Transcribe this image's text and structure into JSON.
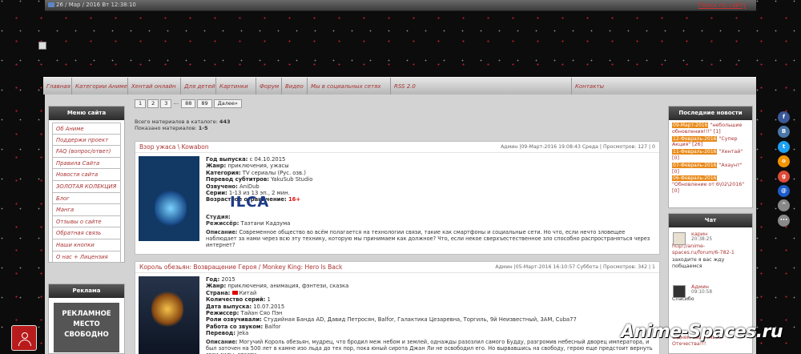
{
  "topbar": {
    "date": "26 / Мар / 2016 Вт 12:38:10",
    "search": "Поиск по сайту"
  },
  "nav": [
    {
      "label": "Главная"
    },
    {
      "label": "Категории Аниме"
    },
    {
      "label": "Хентай онлайн"
    },
    {
      "label": "Для детей"
    },
    {
      "label": "Картинки"
    },
    {
      "label": "Форум"
    },
    {
      "label": "Видео"
    },
    {
      "label": "Мы в социальных сетях"
    },
    {
      "label": "RSS 2.0"
    },
    {
      "label": "Контакты"
    }
  ],
  "menu": {
    "title": "Меню сайта",
    "items": [
      "Об Аниме",
      "Поддержи проект",
      "FAQ (вопрос/ответ)",
      "Правила Сайта",
      "Новости сайта",
      "ЗОЛОТАЯ КОЛЕКЦИЯ",
      "Блог",
      "Манга",
      "Отзывы о сайте",
      "Обратная связь",
      "Наши кнопки",
      "О нас + Лицензия"
    ]
  },
  "ad": {
    "title": "Реклама",
    "line1": "РЕКЛАМНОЕ",
    "line2": "МЕСТО",
    "line3": "СВОБОДНО"
  },
  "pager": {
    "pages": [
      "1",
      "2",
      "3"
    ],
    "ellipsis": "...",
    "pages2": [
      "88",
      "89"
    ],
    "next": "Далее»"
  },
  "stats": {
    "total_label": "Всего материалов в каталоге:",
    "total": "443",
    "shown_label": "Показано материалов:",
    "shown": "1-5"
  },
  "entries": [
    {
      "title": "Взор ужаса \\ Kowabon",
      "meta": "Админ |09-Март-2016 19:08:43 Среда | Просмотров: 127 | 0",
      "fields": [
        {
          "k": "Год выпуска:",
          "v": "с 04.10.2015"
        },
        {
          "k": "Жанр:",
          "v": "приключения, ужасы"
        },
        {
          "k": "Категория:",
          "v": "TV сериалы (Рус. озв.)"
        },
        {
          "k": "Перевод субтитров:",
          "v": "YakuSub Studio"
        },
        {
          "k": "Озвучено:",
          "v": "AniDub"
        },
        {
          "k": "Серии:",
          "v": "1-13 из 13 эп., 2 мин."
        },
        {
          "k": "Возрастное ограничение:",
          "v": "16+"
        }
      ],
      "studio_label": "Студия:",
      "studio_logo": "ILCA",
      "director_label": "Режиссёр:",
      "director": "Таэтани Кадзума",
      "desc_label": "Описание:",
      "desc": "Современное общество во всём полагается на технологии связи, такие как смартфоны и социальные сети. Но что, если нечто зловещее наблюдает за нами через всю эту технику, которую мы принимаем как должное? Что, если некое сверхъестественное зло способно распространяться через интернет?"
    },
    {
      "title": "Король обезьян: Возвращение Героя / Monkey King: Hero Is Back",
      "meta": "Админ |05-Март-2016 16:10:57 Суббота | Просмотров: 342 | 1",
      "fields": [
        {
          "k": "Год:",
          "v": "2015"
        },
        {
          "k": "Жанр:",
          "v": "приключения, анимация, фэнтези, сказка"
        },
        {
          "k": "Страна:",
          "v": "Китай"
        },
        {
          "k": "Количество серий:",
          "v": "1"
        },
        {
          "k": "Дата выпуска:",
          "v": "10.07.2015"
        },
        {
          "k": "Режиссер:",
          "v": "Тайан Сяо Пэн"
        },
        {
          "k": "Роли озвучивали:",
          "v": "Студийная Банда AD, Давид Петросян, Balfor, Галактика Цезаревна, Торгиль, 9й Неизвестный, 3AM, Cuba77"
        },
        {
          "k": "Работа со звуком:",
          "v": "Balfor"
        },
        {
          "k": "Перевод:",
          "v": "Jeka"
        }
      ],
      "desc_label": "Описание:",
      "desc": "Могучий Король обезьян, мудрец, что бродил меж небом и землей, однажды разозлил самого Будду, разгромив небесный дворец императора, и был заточен на 500 лет в камне изо льда до тех пор, пока юный сирота Джан Ли не освободил его. Но вырвавшись на свободу, герою еще предстоит вернуть свои силы, спасти"
    }
  ],
  "news": {
    "title": "Последние новости",
    "items": [
      {
        "date": "09-Март-2016",
        "text": "\"небольшие обновления!!!\" [1]"
      },
      {
        "date": "12-Февраль-2016",
        "text": "\"Супер Акция\" [26]"
      },
      {
        "date": "11-Февраль-2016",
        "text": "\"Хентай\" [0]"
      },
      {
        "date": "07-Февраль-2016",
        "text": "\"Ахаунт\" [0]"
      },
      {
        "date": "06-Февраль-2016",
        "text": "\"Обновление от 6\\02\\2016\" [0]"
      }
    ]
  },
  "chat": {
    "title": "Чат",
    "messages": [
      {
        "name": "карин",
        "time": "20:38:25",
        "link": "http://anime-spaces.ru/forum/6-782-1",
        "text": "заходите я вас жду побщаемся"
      },
      {
        "name": "Админ",
        "time": "09:10:58",
        "link": "",
        "text": "Спасибо"
      }
    ],
    "tail": "С днем защитника Отечества!!!"
  },
  "social": [
    {
      "icon": "facebook-icon",
      "glyph": "f",
      "color": "#3b5998"
    },
    {
      "icon": "vk-icon",
      "glyph": "B",
      "color": "#4a76a8"
    },
    {
      "icon": "twitter-icon",
      "glyph": "t",
      "color": "#1da1f2"
    },
    {
      "icon": "odnoklassniki-icon",
      "glyph": "o",
      "color": "#f29400"
    },
    {
      "icon": "google-plus-icon",
      "glyph": "g",
      "color": "#dd4b39"
    },
    {
      "icon": "mail-icon",
      "glyph": "@",
      "color": "#1c5bc9"
    },
    {
      "icon": "share-icon",
      "glyph": "^",
      "color": "#888888"
    },
    {
      "icon": "more-icon",
      "glyph": "•••",
      "color": "#888888"
    }
  ],
  "watermark": "Anime-Spaces.ru"
}
